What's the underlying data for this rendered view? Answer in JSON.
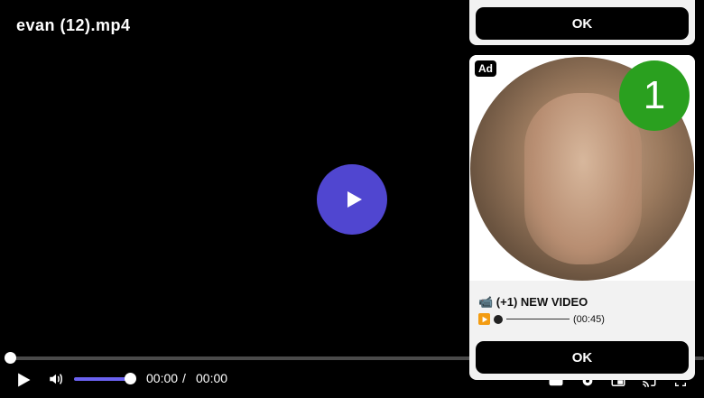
{
  "player": {
    "title": "evan (12).mp4",
    "current_time": "00:00",
    "separator": "/",
    "total_time": "00:00",
    "progress": 0,
    "volume": 1,
    "accent_color": "#5046d0"
  },
  "ad_top": {
    "ok_label": "OK"
  },
  "ad_card": {
    "badge": "Ad",
    "notification_count": "1",
    "headline": "📹 (+1) NEW VIDEO",
    "duration": "(00:45)",
    "ok_label": "OK",
    "badge_color": "#2aa01f"
  },
  "icons": {
    "big_play": "play-icon",
    "play": "play-icon",
    "volume": "volume-icon",
    "right_controls": [
      "captions-icon",
      "settings-icon",
      "pip-icon",
      "cast-icon",
      "fullscreen-icon"
    ]
  }
}
